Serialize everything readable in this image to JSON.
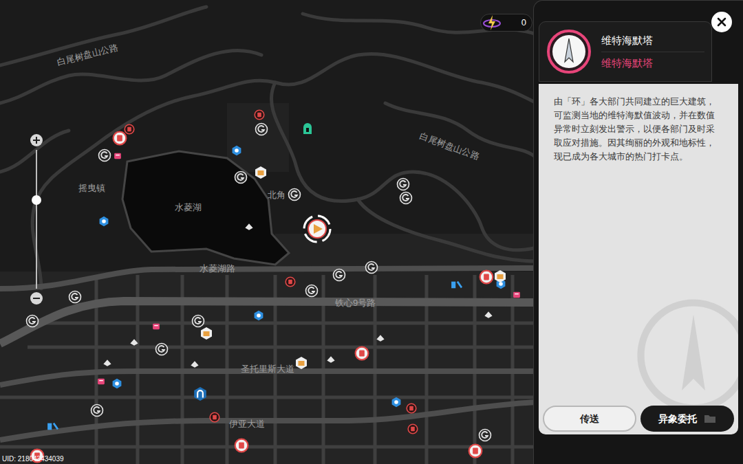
{
  "map": {
    "labels": [
      "白尾树盘山公路",
      "白尾树盘山公路",
      "摇曳镇",
      "水菱湖",
      "北角",
      "水菱湖路",
      "铁心9号路",
      "圣托里斯大道",
      "伊亚大道"
    ]
  },
  "currency": {
    "value": "0"
  },
  "zoom": {
    "level": 0.64
  },
  "panel": {
    "title": "维特海默塔",
    "subtitle": "维特海默塔",
    "description": "由「环」各大部门共同建立的巨大建筑，可监测当地的维特海默值波动，并在数值异常时立刻发出警示，以便各部门及时采取应对措施。因其绚丽的外观和地标性，现已成为各大城市的热门打卡点。",
    "buttons": [
      {
        "label": "传送",
        "kind": "light"
      },
      {
        "label": "异象委托",
        "kind": "dark"
      }
    ]
  },
  "footer": {
    "uid": "UID: 218043434039"
  }
}
